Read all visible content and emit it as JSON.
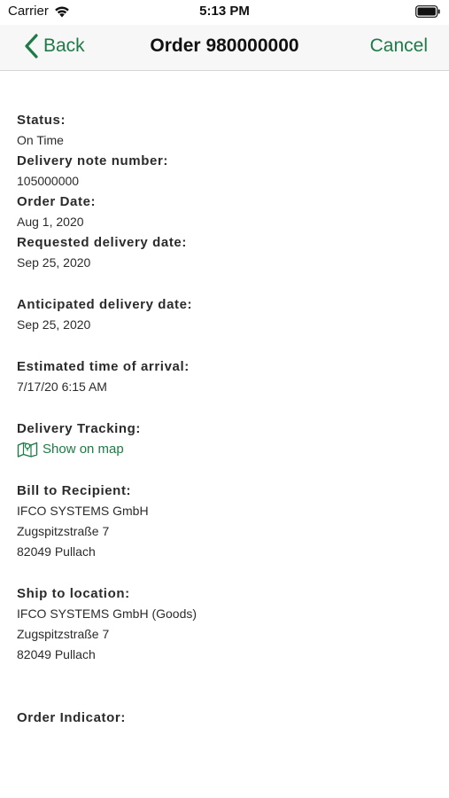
{
  "status_bar": {
    "carrier": "Carrier",
    "time": "5:13 PM"
  },
  "nav": {
    "back_label": "Back",
    "title": "Order 980000000",
    "cancel_label": "Cancel"
  },
  "details": {
    "status_label": "Status:",
    "status_value": "On Time",
    "delivery_note_label": "Delivery note number:",
    "delivery_note_value": "105000000",
    "order_date_label": "Order Date:",
    "order_date_value": "Aug 1, 2020",
    "requested_label": "Requested delivery date:",
    "requested_value": "Sep 25, 2020",
    "anticipated_label": "Anticipated delivery date:",
    "anticipated_value": "Sep 25, 2020",
    "eta_label": "Estimated time of arrival:",
    "eta_value": "7/17/20 6:15 AM",
    "tracking_label": "Delivery Tracking:",
    "tracking_link": "Show on map",
    "bill_label": "Bill to Recipient:",
    "bill_lines": [
      "IFCO SYSTEMS GmbH",
      "Zugspitzstraße 7",
      "82049 Pullach"
    ],
    "ship_label": "Ship to location:",
    "ship_lines": [
      "IFCO SYSTEMS GmbH (Goods)",
      "Zugspitzstraße 7",
      "82049 Pullach"
    ],
    "order_indicator_label": "Order Indicator:"
  },
  "colors": {
    "accent": "#1e7a46",
    "nav_background": "#f7f7f7"
  },
  "icons": {
    "back": "chevron-left-icon",
    "map": "map-icon",
    "wifi": "wifi-icon",
    "battery": "battery-icon"
  }
}
